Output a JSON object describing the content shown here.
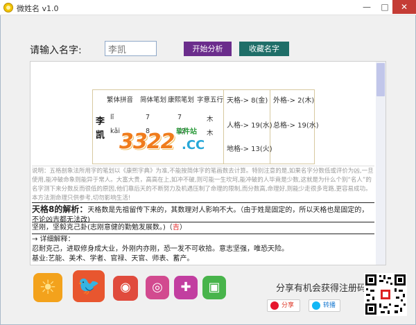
{
  "window": {
    "title": "微姓名 v1.0",
    "min": "—",
    "max": "□",
    "close": "✕"
  },
  "form": {
    "prompt": "请输入名字:",
    "input_value": "李凯",
    "analyze_label": "开始分析",
    "collect_label": "收藏名字"
  },
  "table": {
    "headers": [
      "繁体拼音",
      "简体笔划",
      "康熙笔划",
      "字意五行"
    ],
    "chars": [
      {
        "char": "李",
        "pinyin": "lǐ",
        "simple": "7",
        "kangxi": "7",
        "wuxing": "木"
      },
      {
        "char": "凯",
        "pinyin": "kǎi",
        "simple": "8",
        "kangxi": "12",
        "wuxing": "木"
      }
    ],
    "tian_ge": "天格-> 8(金)",
    "ren_ge": "人格-> 19(水)",
    "di_ge": "地格-> 13(火)",
    "wai_ge": "外格-> 2(木)",
    "zong_ge": "总格-> 19(水)"
  },
  "watermark": {
    "logo": "3322",
    "domain": ".CC",
    "sub": "软件站"
  },
  "description": "说明：五格剖象法所用字的笔划以《康熙字典》为准,不能按简体字的笔画数去计算。特别注意的是,如果名字分数低或评价为凶,一旦使用,能冲破命象则能异于常人。大富大贵，高高在上,如冲不破,则可能一生坎坷,能冲破的人毕竟是少数,这就是为什么个别“名人”的名字测下来分数反而很低的原因,他们靠后天的不断努力及机遇压制了命理的限制,而分数高,命理好,则能少走很多弯路,更容易成功。本方法测命理只供参考,切勿影响生活!",
  "analysis": {
    "title": "天格8的解析：",
    "title_body": "天格数是先祖留传下来的，其数理对人影响不大。（由于姓是固定的，所以天格也是固定的，不论凶吉都无法改)",
    "line2": "坚刚，坚毅克己卦(志刚意健的勤勉发展数。)（",
    "line2_ji": "吉",
    "line2_end": "）",
    "detail_header": "→ 详细解释：",
    "detail_1": "忍耐克己，进取修身成大业，外刚内亦刚，恐一发不可收拾。意志坚强，唯恐天险。",
    "detail_2": "基业:艺能、美术、学者、官禄、天官、师表、蓄产。"
  },
  "apps": [
    {
      "name": "sun-app-icon",
      "glyph": "☀",
      "color": "#f3a21c"
    },
    {
      "name": "bird-app-icon",
      "glyph": "🐦",
      "color": "#e8562f"
    },
    {
      "name": "camera-app-icon",
      "glyph": "◉",
      "color": "#e04b3d"
    },
    {
      "name": "browser-app-icon",
      "glyph": "◎",
      "color": "#d24a8f"
    },
    {
      "name": "game-app-icon",
      "glyph": "✚",
      "color": "#c23ea0"
    },
    {
      "name": "contact-app-icon",
      "glyph": "▣",
      "color": "#48b44b"
    }
  ],
  "share": {
    "text": "分享有机会获得注册码",
    "weibo": "分享",
    "qq": "转播"
  }
}
